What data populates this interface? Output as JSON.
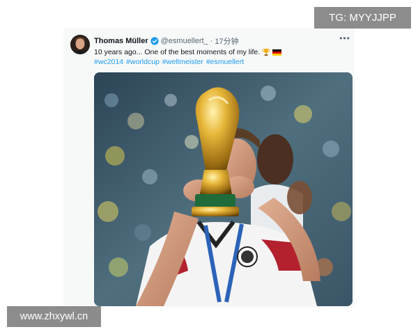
{
  "tweet": {
    "author_name": "Thomas Müller",
    "handle": "@esmuellert_",
    "separator": "·",
    "time_ago": "17分钟",
    "text": "10 years ago... One of the best moments of my life.",
    "emojis": [
      "trophy",
      "germany-flag"
    ],
    "hashtags": [
      "#wc2014",
      "#worldcup",
      "#weltmeister",
      "#esmuellert"
    ],
    "more_icon": "more-horizontal-icon",
    "verified_icon": "verified-badge-icon"
  },
  "media": {
    "alt": "player-kissing-world-cup-trophy"
  },
  "watermarks": {
    "top_right": "TG: MYYJJPP",
    "bottom_left": "www.zhxywl.cn"
  },
  "colors": {
    "link": "#1d9bf0",
    "verified": "#1d9bf0",
    "text": "#0f1419",
    "muted": "#536471",
    "watermark_bg": "#8c8c8c"
  }
}
